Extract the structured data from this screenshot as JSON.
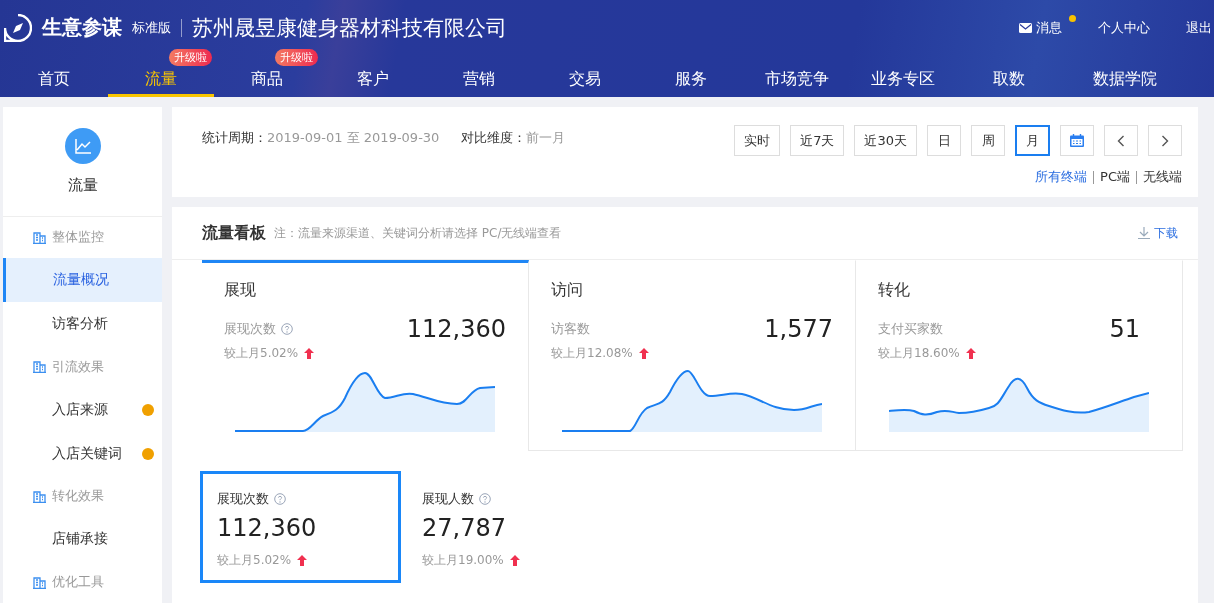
{
  "header": {
    "app_name": "生意参谋",
    "edition": "标准版",
    "company": "苏州晟昱康健身器材科技有限公司",
    "user_links": [
      {
        "label": "消息",
        "kind": "message",
        "unread": true
      },
      {
        "label": "个人中心",
        "kind": "link"
      },
      {
        "label": "退出",
        "kind": "link"
      }
    ],
    "nav": [
      {
        "label": "首页",
        "selected": false
      },
      {
        "label": "流量",
        "selected": true,
        "badge": "升级啦"
      },
      {
        "label": "商品",
        "selected": false,
        "badge": "升级啦"
      },
      {
        "label": "客户",
        "selected": false
      },
      {
        "label": "营销",
        "selected": false
      },
      {
        "label": "交易",
        "selected": false
      },
      {
        "label": "服务",
        "selected": false
      },
      {
        "label": "市场竞争",
        "selected": false
      },
      {
        "label": "业务专区",
        "selected": false
      },
      {
        "label": "取数",
        "selected": false
      },
      {
        "label": "数据学院",
        "selected": false
      }
    ]
  },
  "sidebar": {
    "title": "流量",
    "groups": [
      {
        "label": "整体监控",
        "children": [
          {
            "label": "流量概况",
            "selected": true,
            "dot": false
          },
          {
            "label": "访客分析",
            "selected": false,
            "dot": false
          }
        ]
      },
      {
        "label": "引流效果",
        "children": [
          {
            "label": "入店来源",
            "selected": false,
            "dot": true
          },
          {
            "label": "入店关键词",
            "selected": false,
            "dot": true
          }
        ]
      },
      {
        "label": "转化效果",
        "children": [
          {
            "label": "店铺承接",
            "selected": false,
            "dot": false
          }
        ]
      },
      {
        "label": "优化工具"
      }
    ]
  },
  "filter": {
    "period_label": "统计周期：",
    "period": "2019-09-01 至 2019-09-30",
    "compare_label": "对比维度：",
    "compare_value": "前一月",
    "range_buttons": [
      {
        "label": "实时",
        "selected": false
      },
      {
        "label": "近7天",
        "selected": false
      },
      {
        "label": "近30天",
        "selected": false
      },
      {
        "label": "日",
        "selected": false
      },
      {
        "label": "周",
        "selected": false
      },
      {
        "label": "月",
        "selected": true
      }
    ],
    "terminals": [
      {
        "label": "所有终端",
        "selected": true
      },
      {
        "label": "PC端",
        "selected": false
      },
      {
        "label": "无线端",
        "selected": false
      }
    ]
  },
  "board": {
    "title": "流量看板",
    "note": "注：流量来源渠道、关键词分析请选择 PC/无线端查看",
    "download": "下载",
    "metric_cards": [
      {
        "title": "展现",
        "metric": "展现次数",
        "help": true,
        "value": "112,360",
        "change": "较上月5.02%",
        "selected": true
      },
      {
        "title": "访问",
        "metric": "访客数",
        "value": "1,577",
        "change": "较上月12.08%",
        "selected": false
      },
      {
        "title": "转化",
        "metric": "支付买家数",
        "value": "51",
        "change": "较上月18.60%",
        "selected": false
      }
    ],
    "sub_metrics": [
      {
        "label": "展现次数",
        "value": "112,360",
        "change": "较上月5.02%",
        "selected": true
      },
      {
        "label": "展现人数",
        "value": "27,787",
        "change": "较上月19.00%",
        "selected": false
      }
    ]
  }
}
